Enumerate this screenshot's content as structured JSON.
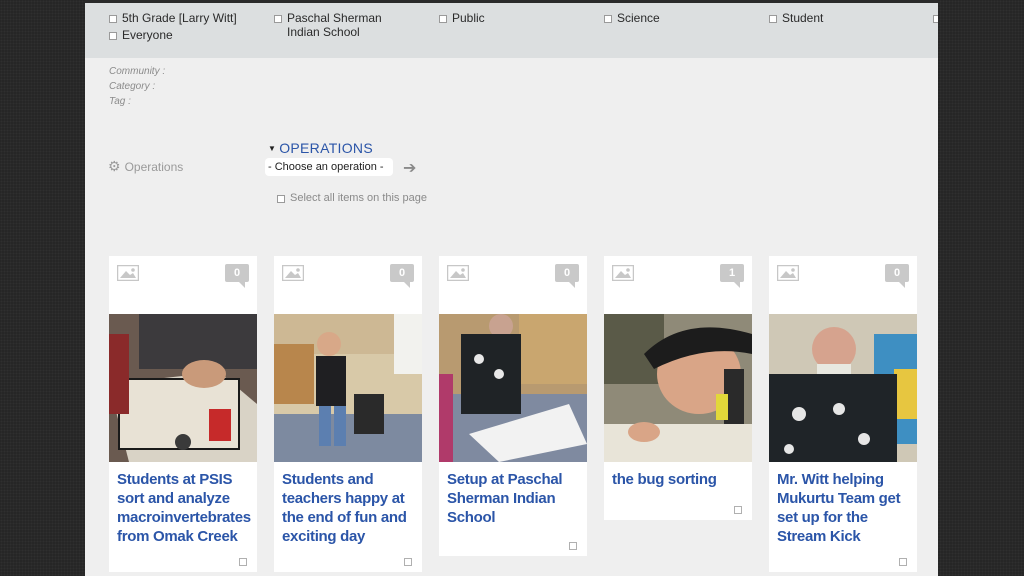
{
  "filters": [
    {
      "label": "5th Grade [Larry Witt]"
    },
    {
      "label": "Everyone"
    },
    {
      "label": "Paschal Sherman Indian School"
    },
    {
      "label": "Public"
    },
    {
      "label": "Science"
    },
    {
      "label": "Student"
    }
  ],
  "meta": {
    "community": "Community :",
    "category": "Category :",
    "tag": "Tag :"
  },
  "operations": {
    "label": "Operations",
    "title": "OPERATIONS",
    "select_value": "- Choose an operation -",
    "select_all": "Select all items on this page"
  },
  "cards": [
    {
      "title": "Students at PSIS sort and analyze macroinvertebrates from Omak Creek",
      "comments": "0"
    },
    {
      "title": "Students and teachers happy at the end of fun and exciting day",
      "comments": "0"
    },
    {
      "title": "Setup at Paschal Sherman Indian School",
      "comments": "0"
    },
    {
      "title": "the bug sorting",
      "comments": "1"
    },
    {
      "title": "Mr. Witt helping Mukurtu Team get set up for the Stream Kick",
      "comments": "0"
    }
  ],
  "colors": {
    "link": "#2b55a8",
    "panel": "#efefef",
    "filterbar": "#dcdfe0"
  }
}
